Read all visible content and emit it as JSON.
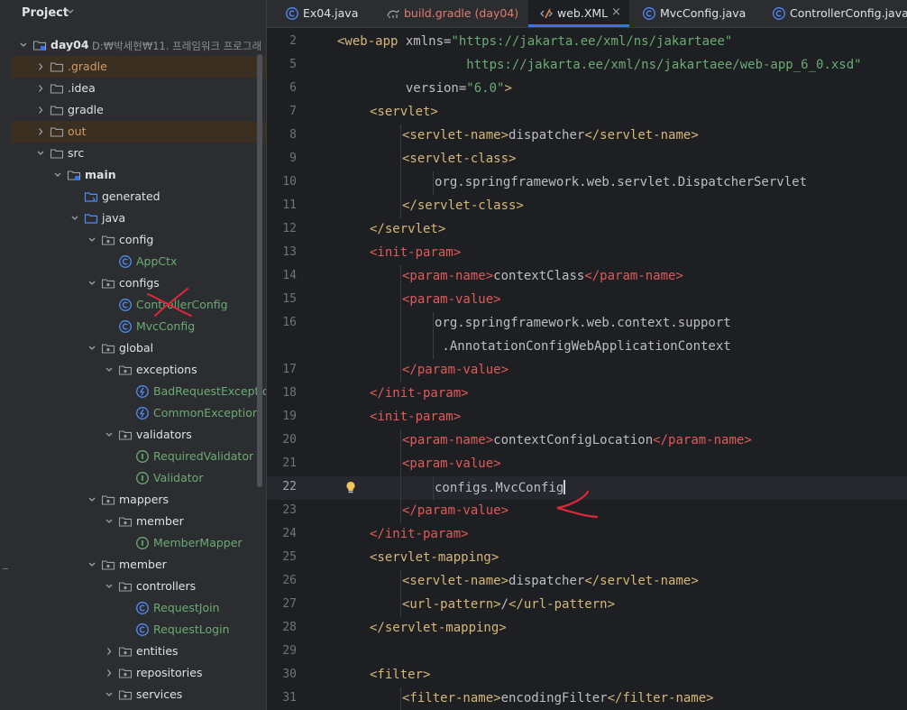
{
  "project_panel": {
    "title": "Project",
    "tree": [
      {
        "label": "day04",
        "path": "D:₩박세현₩11. 프레임워크 프로그래",
        "icon": "module-folder-icon",
        "chevron": "down",
        "indent": 0,
        "style": "bold"
      },
      {
        "label": ".gradle",
        "icon": "folder-icon",
        "chevron": "right",
        "indent": 1,
        "style": "orange",
        "excluded": true
      },
      {
        "label": ".idea",
        "icon": "folder-icon",
        "chevron": "right",
        "indent": 1,
        "style": ""
      },
      {
        "label": "gradle",
        "icon": "folder-icon",
        "chevron": "right",
        "indent": 1,
        "style": ""
      },
      {
        "label": "out",
        "icon": "folder-icon",
        "chevron": "right",
        "indent": 1,
        "style": "orange",
        "excluded": true
      },
      {
        "label": "src",
        "icon": "folder-icon",
        "chevron": "down",
        "indent": 1,
        "style": ""
      },
      {
        "label": "main",
        "icon": "module-folder-icon",
        "chevron": "down",
        "indent": 2,
        "style": "bold"
      },
      {
        "label": "generated",
        "icon": "generated-folder-icon",
        "chevron": "",
        "indent": 3,
        "style": ""
      },
      {
        "label": "java",
        "icon": "source-folder-icon",
        "chevron": "down",
        "indent": 3,
        "style": ""
      },
      {
        "label": "config",
        "icon": "package-icon",
        "chevron": "down",
        "indent": 4,
        "style": ""
      },
      {
        "label": "AppCtx",
        "icon": "class-icon",
        "chevron": "",
        "indent": 5,
        "style": "green"
      },
      {
        "label": "configs",
        "icon": "package-icon",
        "chevron": "down",
        "indent": 4,
        "style": ""
      },
      {
        "label": "ControllerConfig",
        "icon": "class-icon",
        "chevron": "",
        "indent": 5,
        "style": "green",
        "crossed": true
      },
      {
        "label": "MvcConfig",
        "icon": "class-icon",
        "chevron": "",
        "indent": 5,
        "style": "green"
      },
      {
        "label": "global",
        "icon": "package-icon",
        "chevron": "down",
        "indent": 4,
        "style": ""
      },
      {
        "label": "exceptions",
        "icon": "package-icon",
        "chevron": "down",
        "indent": 5,
        "style": ""
      },
      {
        "label": "BadRequestException",
        "icon": "exception-icon",
        "chevron": "",
        "indent": 6,
        "style": "green"
      },
      {
        "label": "CommonException",
        "icon": "exception-icon",
        "chevron": "",
        "indent": 6,
        "style": "green"
      },
      {
        "label": "validators",
        "icon": "package-icon",
        "chevron": "down",
        "indent": 5,
        "style": ""
      },
      {
        "label": "RequiredValidator",
        "icon": "interface-icon",
        "chevron": "",
        "indent": 6,
        "style": "green"
      },
      {
        "label": "Validator",
        "icon": "interface-icon",
        "chevron": "",
        "indent": 6,
        "style": "green"
      },
      {
        "label": "mappers",
        "icon": "package-icon",
        "chevron": "down",
        "indent": 4,
        "style": ""
      },
      {
        "label": "member",
        "icon": "package-icon",
        "chevron": "down",
        "indent": 5,
        "style": ""
      },
      {
        "label": "MemberMapper",
        "icon": "interface-icon",
        "chevron": "",
        "indent": 6,
        "style": "green"
      },
      {
        "label": "member",
        "icon": "package-icon",
        "chevron": "down",
        "indent": 4,
        "style": ""
      },
      {
        "label": "controllers",
        "icon": "package-icon",
        "chevron": "down",
        "indent": 5,
        "style": ""
      },
      {
        "label": "RequestJoin",
        "icon": "class-icon",
        "chevron": "",
        "indent": 6,
        "style": "green"
      },
      {
        "label": "RequestLogin",
        "icon": "class-icon",
        "chevron": "",
        "indent": 6,
        "style": "green"
      },
      {
        "label": "entities",
        "icon": "package-icon",
        "chevron": "right",
        "indent": 5,
        "style": ""
      },
      {
        "label": "repositories",
        "icon": "package-icon",
        "chevron": "right",
        "indent": 5,
        "style": ""
      },
      {
        "label": "services",
        "icon": "package-icon",
        "chevron": "down",
        "indent": 5,
        "style": ""
      }
    ]
  },
  "tabs": [
    {
      "label": "Ex04.java",
      "icon": "java-class-icon",
      "color": "#dfe1e5",
      "active": false
    },
    {
      "label": "build.gradle (day04)",
      "icon": "gradle-icon",
      "color": "#e07a6f",
      "active": false
    },
    {
      "label": "web.XML",
      "icon": "xml-file-icon",
      "color": "#dfe1e5",
      "active": true,
      "closable": true
    },
    {
      "label": "MvcConfig.java",
      "icon": "java-class-icon",
      "color": "#dfe1e5",
      "active": false
    },
    {
      "label": "ControllerConfig.java",
      "icon": "java-class-icon",
      "color": "#dfe1e5",
      "active": false
    }
  ],
  "editor": {
    "current_line": "22",
    "lines": [
      {
        "num": "2",
        "indent": 0,
        "parts": [
          [
            "t",
            "<web-app "
          ],
          [
            "a",
            "xmlns="
          ],
          [
            "s",
            "\"https://jakarta.ee/xml/ns/jakartaee\""
          ]
        ]
      },
      {
        "num": "5",
        "indent": 0,
        "parts": [
          [
            "s",
            "                 https://jakarta.ee/xml/ns/jakartaee/web-app_6_0.xsd\""
          ]
        ]
      },
      {
        "num": "6",
        "indent": 0,
        "parts": [
          [
            "a",
            "         version="
          ],
          [
            "s",
            "\"6.0\""
          ],
          [
            "t",
            ">"
          ]
        ]
      },
      {
        "num": "7",
        "indent": 1,
        "parts": [
          [
            "t",
            "<servlet>"
          ]
        ]
      },
      {
        "num": "8",
        "indent": 2,
        "parts": [
          [
            "t",
            "<servlet-name>"
          ],
          [
            "a",
            "dispatcher"
          ],
          [
            "t",
            "</servlet-name>"
          ]
        ]
      },
      {
        "num": "9",
        "indent": 2,
        "parts": [
          [
            "t",
            "<servlet-class>"
          ]
        ]
      },
      {
        "num": "10",
        "indent": 3,
        "parts": [
          [
            "a",
            "org.springframework.web.servlet.DispatcherServlet"
          ]
        ]
      },
      {
        "num": "11",
        "indent": 2,
        "parts": [
          [
            "t",
            "</servlet-class>"
          ]
        ]
      },
      {
        "num": "12",
        "indent": 1,
        "parts": [
          [
            "t",
            "</servlet>"
          ]
        ]
      },
      {
        "num": "13",
        "indent": 1,
        "parts": [
          [
            "r",
            "<init-param>"
          ]
        ]
      },
      {
        "num": "14",
        "indent": 2,
        "parts": [
          [
            "r",
            "<param-name>"
          ],
          [
            "a",
            "contextClass"
          ],
          [
            "r",
            "</param-name>"
          ]
        ]
      },
      {
        "num": "15",
        "indent": 2,
        "parts": [
          [
            "r",
            "<param-value>"
          ]
        ]
      },
      {
        "num": "16",
        "indent": 3,
        "parts": [
          [
            "a",
            "org.springframework.web.context.support"
          ]
        ]
      },
      {
        "num": "",
        "indent": 3,
        "parts": [
          [
            "a",
            " .AnnotationConfigWebApplicationContext"
          ]
        ]
      },
      {
        "num": "17",
        "indent": 2,
        "parts": [
          [
            "r",
            "</param-value>"
          ]
        ]
      },
      {
        "num": "18",
        "indent": 1,
        "parts": [
          [
            "r",
            "</init-param>"
          ]
        ]
      },
      {
        "num": "19",
        "indent": 1,
        "parts": [
          [
            "r",
            "<init-param>"
          ]
        ]
      },
      {
        "num": "20",
        "indent": 2,
        "parts": [
          [
            "r",
            "<param-name>"
          ],
          [
            "a",
            "contextConfigLocation"
          ],
          [
            "r",
            "</param-name>"
          ]
        ]
      },
      {
        "num": "21",
        "indent": 2,
        "parts": [
          [
            "r",
            "<param-value>"
          ]
        ]
      },
      {
        "num": "22",
        "indent": 3,
        "parts": [
          [
            "a",
            "configs.MvcConfig"
          ]
        ]
      },
      {
        "num": "23",
        "indent": 2,
        "parts": [
          [
            "r",
            "</param-value>"
          ]
        ]
      },
      {
        "num": "24",
        "indent": 1,
        "parts": [
          [
            "r",
            "</init-param>"
          ]
        ]
      },
      {
        "num": "25",
        "indent": 1,
        "parts": [
          [
            "t",
            "<servlet-mapping>"
          ]
        ]
      },
      {
        "num": "26",
        "indent": 2,
        "parts": [
          [
            "t",
            "<servlet-name>"
          ],
          [
            "a",
            "dispatcher"
          ],
          [
            "t",
            "</servlet-name>"
          ]
        ]
      },
      {
        "num": "27",
        "indent": 2,
        "parts": [
          [
            "t",
            "<url-pattern>"
          ],
          [
            "a",
            "/"
          ],
          [
            "t",
            "</url-pattern>"
          ]
        ]
      },
      {
        "num": "28",
        "indent": 1,
        "parts": [
          [
            "t",
            "</servlet-mapping>"
          ]
        ]
      },
      {
        "num": "29",
        "indent": 0,
        "parts": []
      },
      {
        "num": "30",
        "indent": 1,
        "parts": [
          [
            "t",
            "<filter>"
          ]
        ]
      },
      {
        "num": "31",
        "indent": 2,
        "parts": [
          [
            "t",
            "<filter-name>"
          ],
          [
            "a",
            "encodingFilter"
          ],
          [
            "t",
            "</filter-name>"
          ]
        ]
      }
    ]
  },
  "colors": {
    "accent": "#3574f0",
    "tag": "#d5b778",
    "tag_highlight": "#e05a5a",
    "string": "#6aab73",
    "annotation_ink": "#e0283a"
  }
}
